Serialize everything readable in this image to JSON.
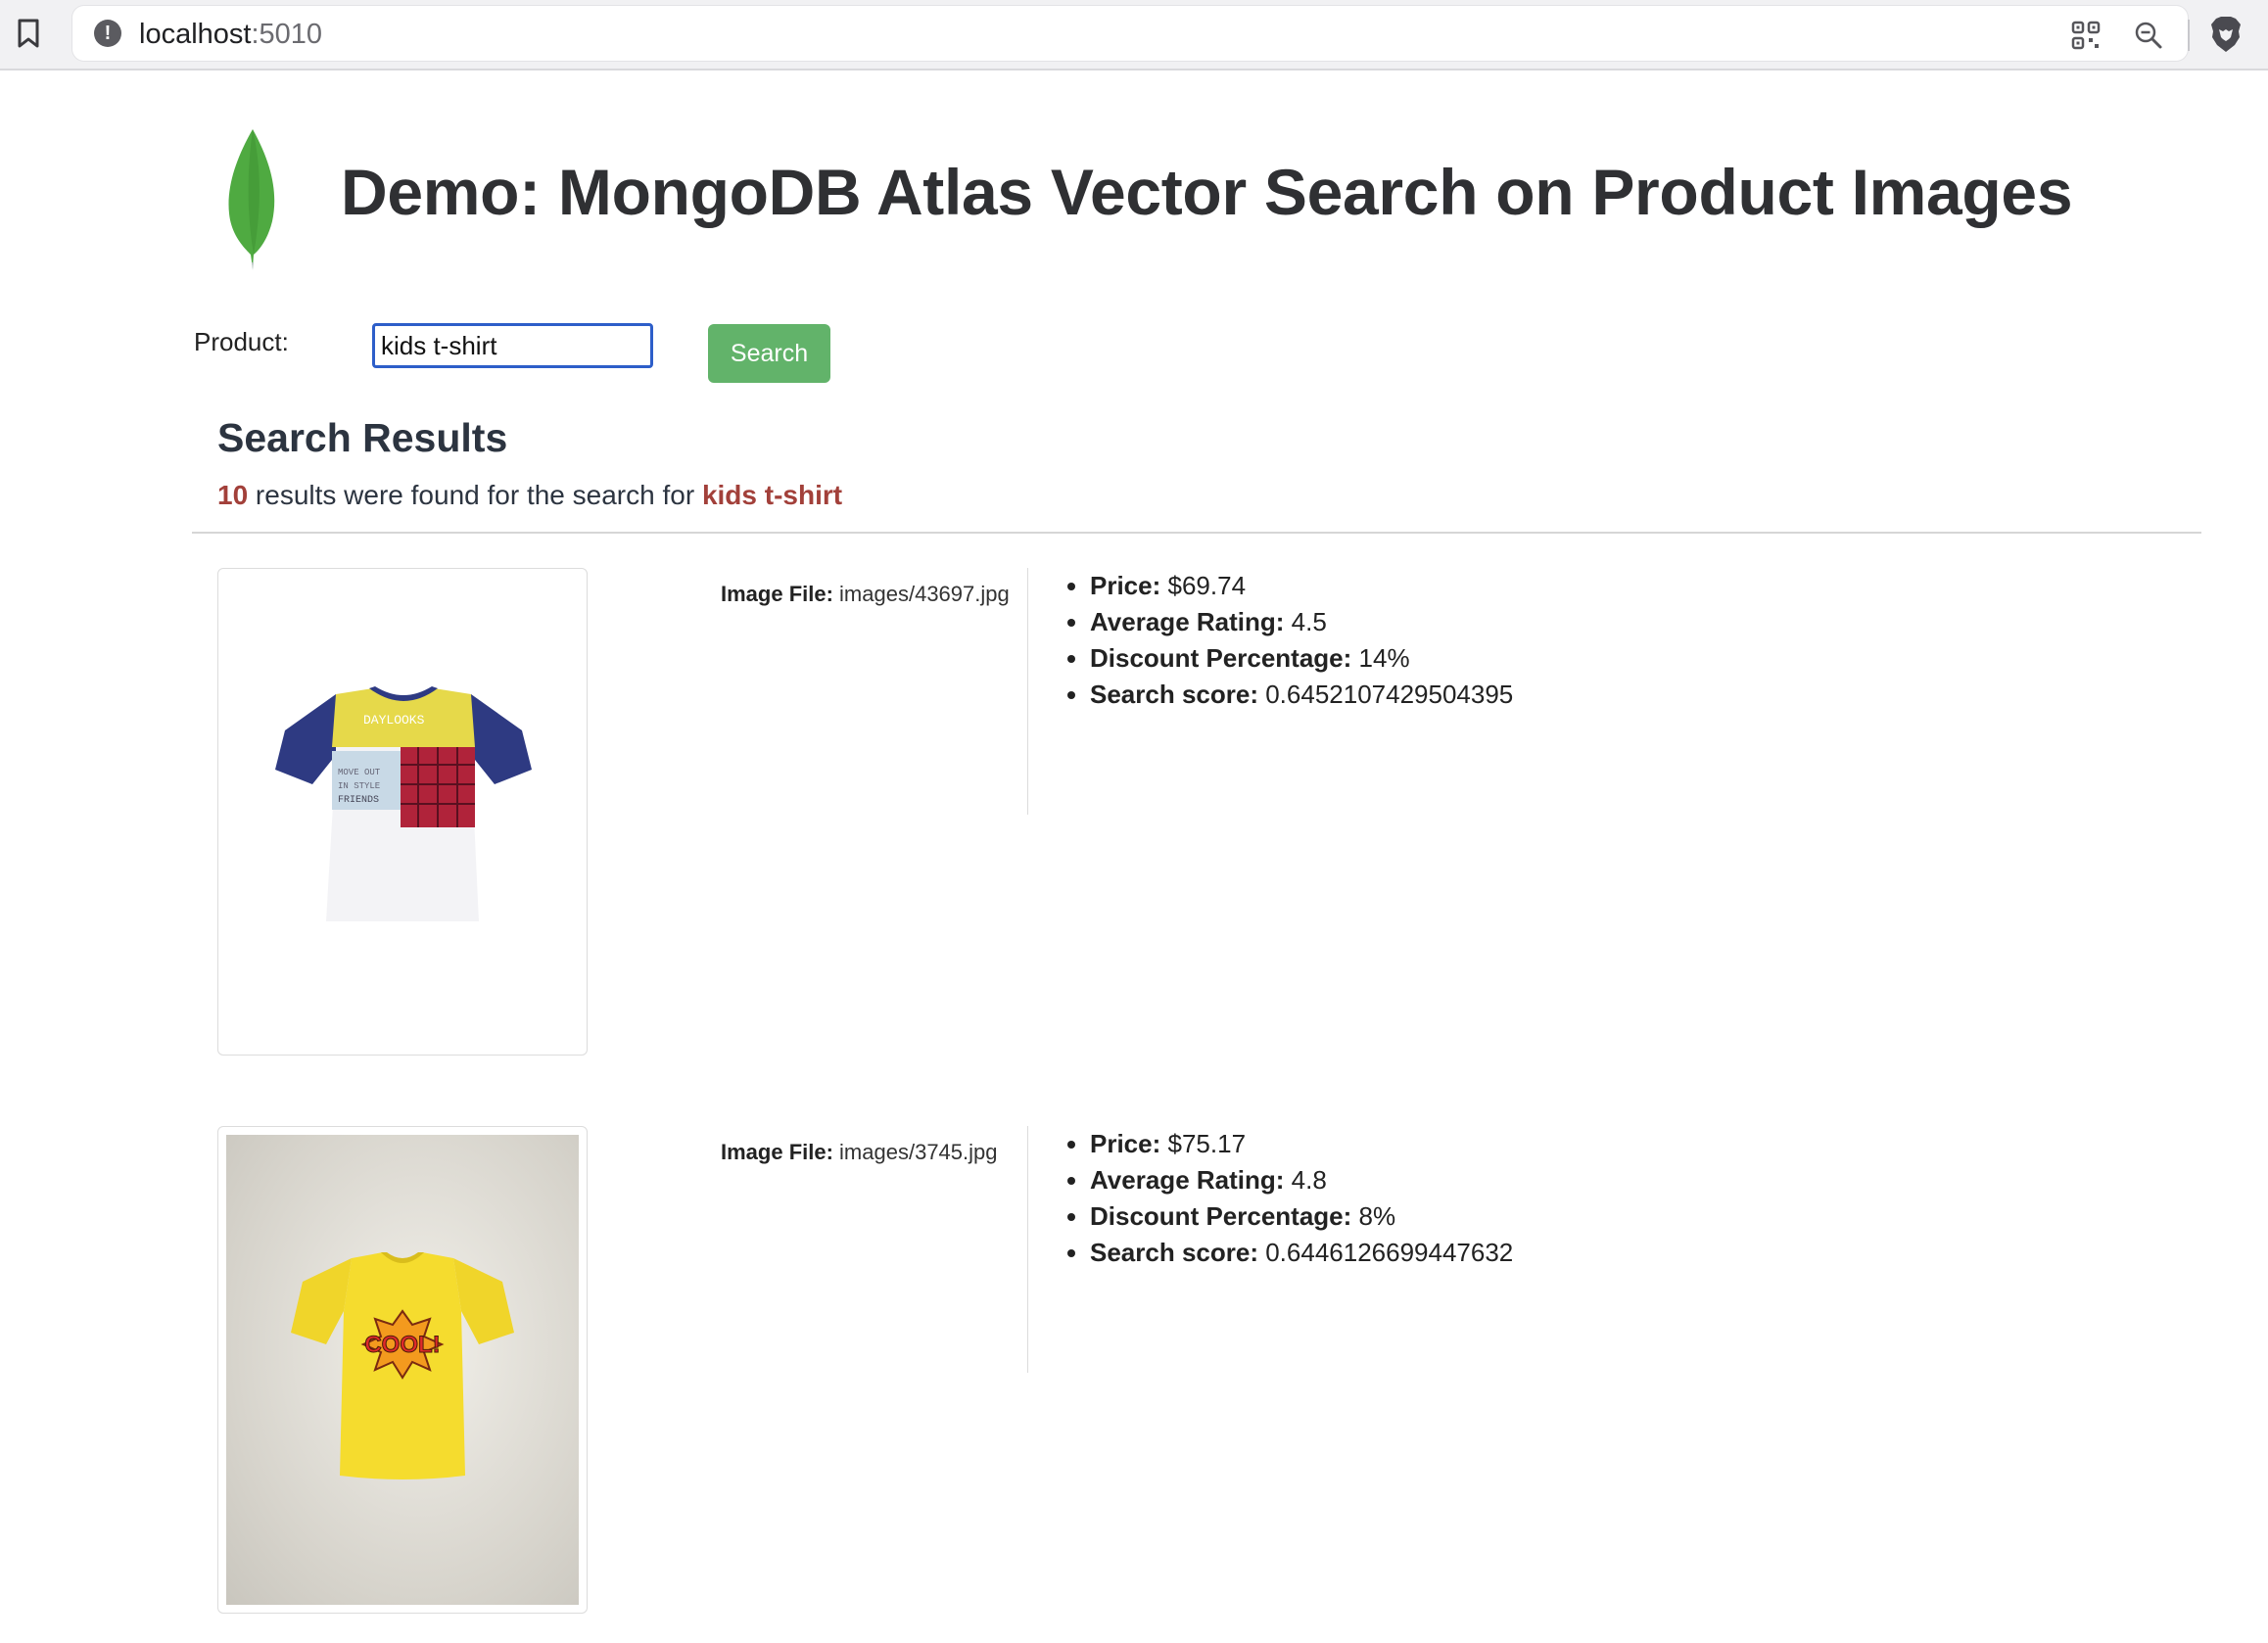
{
  "browser": {
    "url_host": "localhost",
    "url_port": ":5010"
  },
  "page": {
    "title": "Demo: MongoDB Atlas Vector Search on Product Images"
  },
  "search": {
    "label": "Product:",
    "value": "kids t-shirt",
    "button_label": "Search"
  },
  "results": {
    "heading": "Search Results",
    "count": "10",
    "summary_mid": " results were found for the search for ",
    "query": "kids t-shirt",
    "items": [
      {
        "image_file_label": "Image File:",
        "image_file": "images/43697.jpg",
        "price_label": "Price:",
        "price": "$69.74",
        "rating_label": "Average Rating:",
        "rating": "4.5",
        "discount_label": "Discount Percentage:",
        "discount": "14%",
        "score_label": "Search score:",
        "score": "0.6452107429504395",
        "shirt_text": "DAYLOOKS"
      },
      {
        "image_file_label": "Image File:",
        "image_file": "images/3745.jpg",
        "price_label": "Price:",
        "price": "$75.17",
        "rating_label": "Average Rating:",
        "rating": "4.8",
        "discount_label": "Discount Percentage:",
        "discount": "8%",
        "score_label": "Search score:",
        "score": "0.6446126699447632",
        "shirt_text": "COOL!"
      }
    ]
  },
  "icons": {
    "bookmark": "bookmark-icon",
    "info": "info-icon",
    "qr": "qr-code-icon",
    "zoom": "zoom-out-icon",
    "brave": "brave-lion-icon",
    "logo": "mongodb-leaf-logo"
  },
  "colors": {
    "search_button": "#62b36a",
    "highlight": "#a2403a",
    "input_border": "#2d5ec9",
    "leaf": "#4faa41"
  }
}
